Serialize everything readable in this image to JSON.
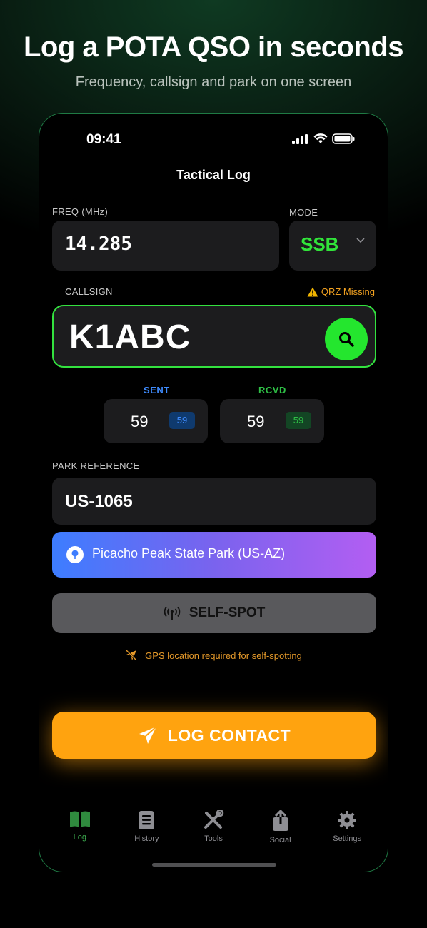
{
  "promo": {
    "headline": "Log a POTA QSO in seconds",
    "subheadline": "Frequency, callsign and park on one screen"
  },
  "status_bar": {
    "time": "09:41"
  },
  "screen": {
    "title": "Tactical Log"
  },
  "frequency": {
    "label": "FREQ (MHz)",
    "value": "14.285"
  },
  "mode": {
    "label": "MODE",
    "value": "SSB"
  },
  "callsign": {
    "label": "CALLSIGN",
    "warning": "QRZ Missing",
    "value": "K1ABC"
  },
  "rst": {
    "sent_label": "SENT",
    "sent_value": "59",
    "sent_badge": "59",
    "rcvd_label": "RCVD",
    "rcvd_value": "59",
    "rcvd_badge": "59"
  },
  "park": {
    "label": "PARK REFERENCE",
    "reference": "US-1065",
    "name": "Picacho Peak State Park (US-AZ)"
  },
  "self_spot": {
    "label": "SELF-SPOT",
    "note": "GPS location required for self-spotting"
  },
  "log_contact": {
    "label": "LOG CONTACT"
  },
  "tabs": [
    {
      "label": "Log",
      "icon": "book-icon"
    },
    {
      "label": "History",
      "icon": "list-icon"
    },
    {
      "label": "Tools",
      "icon": "tools-icon"
    },
    {
      "label": "Social",
      "icon": "share-icon"
    },
    {
      "label": "Settings",
      "icon": "gear-icon"
    }
  ],
  "colors": {
    "accent_green": "#33e23f",
    "log_orange": "#ffa30f",
    "sent_blue": "#3f8cff",
    "rcvd_green": "#2fc046",
    "warning_orange": "#f0a020"
  }
}
